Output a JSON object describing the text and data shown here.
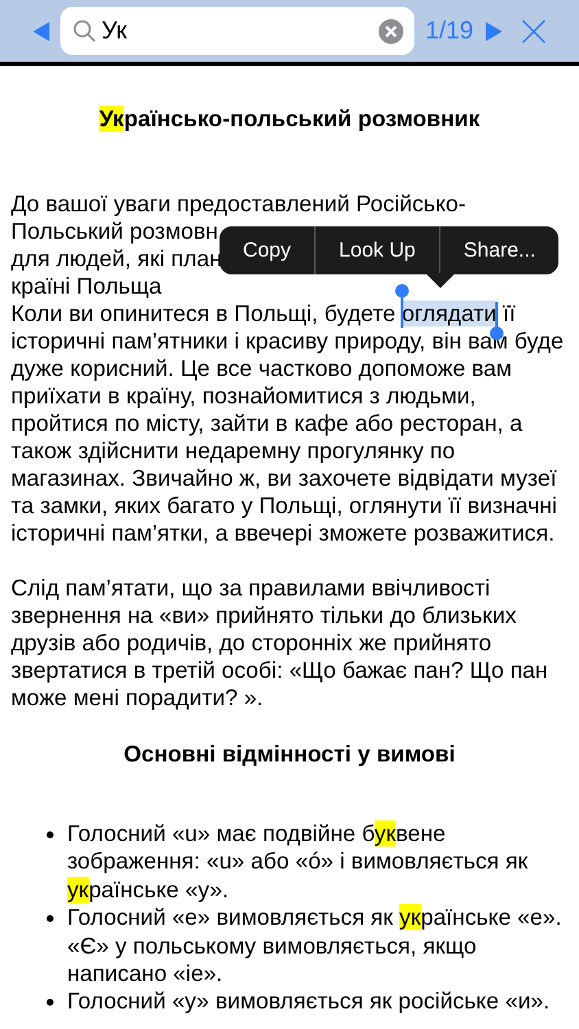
{
  "search_bar": {
    "query": "Ук",
    "match_counter": "1/19"
  },
  "document": {
    "title": [
      {
        "text": "Ук",
        "kind": "match"
      },
      {
        "text": "раїнсько-польський розмовник",
        "kind": "plain"
      }
    ],
    "blocks": [
      {
        "kind": "paragraph",
        "lines": [
          [
            {
              "text": "До вашої уваги предоставлений Російсько-",
              "kind": "plain"
            }
          ],
          [
            {
              "text": "Польський розмовн",
              "kind": "plain"
            }
          ],
          [
            {
              "text": "для людей, які план",
              "kind": "plain"
            }
          ],
          [
            {
              "text": "країні Польща",
              "kind": "plain"
            }
          ],
          [
            {
              "text": "Коли ви опинитеся в Польщі, будете ",
              "kind": "plain"
            },
            {
              "text": "оглядати",
              "kind": "selection"
            },
            {
              "text": " її",
              "kind": "plain"
            }
          ],
          [
            {
              "text": "історичні пам’ятники і красиву природу, він вам буде",
              "kind": "plain"
            }
          ],
          [
            {
              "text": "дуже корисний. Це все частково допоможе вам",
              "kind": "plain"
            }
          ],
          [
            {
              "text": "приїхати в країну, познайомитися з людьми,",
              "kind": "plain"
            }
          ],
          [
            {
              "text": "пройтися по місту, зайти в кафе або ресторан, а",
              "kind": "plain"
            }
          ],
          [
            {
              "text": "також здійснити недаремну прогулянку по",
              "kind": "plain"
            }
          ],
          [
            {
              "text": "магазинах. Звичайно ж, ви захочете відвідати музеї",
              "kind": "plain"
            }
          ],
          [
            {
              "text": "та замки, яких багато у Польщі, оглянути її визначні",
              "kind": "plain"
            }
          ],
          [
            {
              "text": "історичні пам’ятки, а ввечері зможете розважитися.",
              "kind": "plain"
            }
          ]
        ]
      },
      {
        "kind": "paragraph",
        "lines": [
          [
            {
              "text": "Слід пам’ятати, що за правилами ввічливості",
              "kind": "plain"
            }
          ],
          [
            {
              "text": "звернення на «ви» прийнято тільки до близьких",
              "kind": "plain"
            }
          ],
          [
            {
              "text": "друзів або родичів, до сторонніх же прийнято",
              "kind": "plain"
            }
          ],
          [
            {
              "text": "звертатися в третій особі: «Що бажає пан? Що пан",
              "kind": "plain"
            }
          ],
          [
            {
              "text": "може мені порадити? ».",
              "kind": "plain"
            }
          ]
        ]
      },
      {
        "kind": "heading",
        "lines": [
          [
            {
              "text": "Основні відмінності у вимові",
              "kind": "plain"
            }
          ]
        ]
      },
      {
        "kind": "list",
        "items": [
          {
            "lines": [
              [
                {
                  "text": "Голосний «u» має подвійне б",
                  "kind": "plain"
                },
                {
                  "text": "ук",
                  "kind": "match"
                },
                {
                  "text": "вене",
                  "kind": "plain"
                }
              ],
              [
                {
                  "text": "зображення: «u» або «ó» і вимовляється як",
                  "kind": "plain"
                }
              ],
              [
                {
                  "text": "ук",
                  "kind": "match"
                },
                {
                  "text": "раїнське «у».",
                  "kind": "plain"
                }
              ]
            ]
          },
          {
            "lines": [
              [
                {
                  "text": "Голосний «е» вимовляється як ",
                  "kind": "plain"
                },
                {
                  "text": "ук",
                  "kind": "match"
                },
                {
                  "text": "раїнське «е».",
                  "kind": "plain"
                }
              ],
              [
                {
                  "text": "«Є» у польському вимовляється, якщо",
                  "kind": "plain"
                }
              ],
              [
                {
                  "text": "написано «іе».",
                  "kind": "plain"
                }
              ]
            ]
          },
          {
            "lines": [
              [
                {
                  "text": "Голосний «у» вимовляється як російське «и».",
                  "kind": "plain"
                }
              ]
            ]
          }
        ]
      }
    ]
  },
  "context_menu": {
    "items": [
      "Copy",
      "Look Up",
      "Share..."
    ]
  }
}
